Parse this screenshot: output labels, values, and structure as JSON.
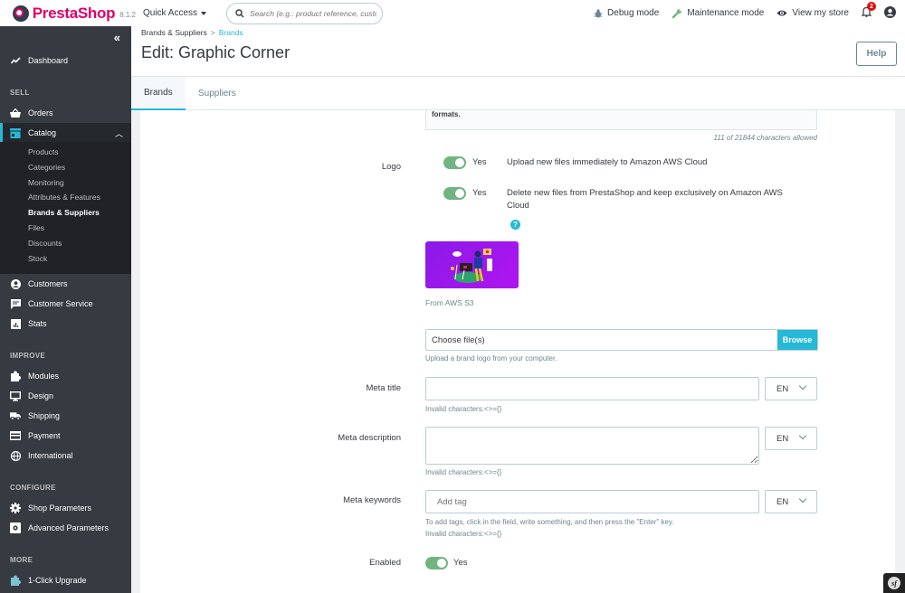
{
  "header": {
    "brand": "PrestaShop",
    "version": "8.1.2",
    "quick_access": "Quick Access",
    "search_placeholder": "Search (e.g.: product reference, custon",
    "debug_mode": "Debug mode",
    "maintenance_mode": "Maintenance mode",
    "view_store": "View my store",
    "notification_count": "2"
  },
  "sidebar": {
    "dashboard": "Dashboard",
    "sections": {
      "sell": "SELL",
      "improve": "IMPROVE",
      "configure": "CONFIGURE",
      "more": "MORE"
    },
    "items": {
      "orders": "Orders",
      "catalog": "Catalog",
      "customers": "Customers",
      "customer_service": "Customer Service",
      "stats": "Stats",
      "modules": "Modules",
      "design": "Design",
      "shipping": "Shipping",
      "payment": "Payment",
      "international": "International",
      "shop_parameters": "Shop Parameters",
      "advanced_parameters": "Advanced Parameters",
      "upgrade": "1-Click Upgrade"
    },
    "catalog_sub": [
      "Products",
      "Categories",
      "Monitoring",
      "Attributes & Features",
      "Brands & Suppliers",
      "Files",
      "Discounts",
      "Stock"
    ],
    "active_sub": "Brands & Suppliers"
  },
  "page": {
    "breadcrumb_parent": "Brands & Suppliers",
    "breadcrumb_sep": ">",
    "breadcrumb_current": "Brands",
    "title": "Edit: Graphic Corner",
    "help": "Help",
    "tabs": [
      "Brands",
      "Suppliers"
    ],
    "active_tab": "Brands"
  },
  "form": {
    "description_tail": "formats.",
    "char_counter": "111 of 21844 characters allowed",
    "logo_label": "Logo",
    "aws_upload": {
      "state": "Yes",
      "on": true,
      "desc": "Upload new files immediately to Amazon AWS Cloud"
    },
    "aws_delete": {
      "state": "Yes",
      "on": true,
      "desc": "Delete new files from PrestaShop and keep exclusively on Amazon AWS Cloud"
    },
    "logo_source": "From AWS S3",
    "file_placeholder": "Choose file(s)",
    "browse": "Browse",
    "upload_hint": "Upload a brand logo from your computer.",
    "meta_title_label": "Meta title",
    "meta_title_value": "",
    "meta_description_label": "Meta description",
    "meta_description_value": "",
    "meta_keywords_label": "Meta keywords",
    "meta_keywords_placeholder": "Add tag",
    "language": "EN",
    "invalid_chars": "Invalid characters:<>={}",
    "tags_hint": "To add tags, click in the field, write something, and then press the \"Enter\" key.",
    "enabled_label": "Enabled",
    "enabled_state": "Yes",
    "enabled_on": true
  },
  "colors": {
    "accent": "#25b9d7",
    "brand": "#df0067",
    "switch_on": "#70b580",
    "sidebar_bg": "#363a41"
  }
}
